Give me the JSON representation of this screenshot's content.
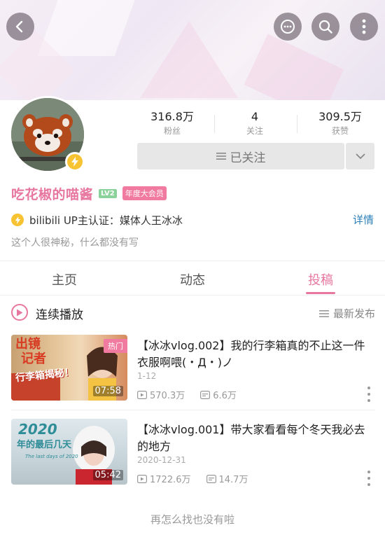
{
  "header": {
    "back_icon": "back-arrow-icon",
    "message_icon": "message-dots-icon",
    "search_icon": "search-icon",
    "more_icon": "more-vertical-icon"
  },
  "profile": {
    "name": "吃花椒的喵酱",
    "level": "LV2",
    "vip_badge": "年度大会员",
    "stats": {
      "fans_value": "316.8万",
      "fans_label": "粉丝",
      "following_value": "4",
      "following_label": "关注",
      "likes_value": "309.5万",
      "likes_label": "获赞"
    },
    "follow_button": "已关注",
    "certification": "bilibili UP主认证：媒体人王冰冰",
    "detail_link": "详情",
    "bio": "这个人很神秘，什么都没有写"
  },
  "tabs": [
    {
      "label": "主页"
    },
    {
      "label": "动态"
    },
    {
      "label": "投稿"
    }
  ],
  "playlist": {
    "play_label": "连续播放",
    "sort_label": "最新发布"
  },
  "videos": [
    {
      "title": "【冰冰vlog.002】我的行李箱真的不止这一件衣服啊喂(・Д・)ノ",
      "date": "1-12",
      "views": "570.3万",
      "danmaku": "6.6万",
      "duration": "07:58",
      "tag": "热门",
      "thumb_text_1": "出镜",
      "thumb_text_2": "记者",
      "thumb_text_3": "行李箱揭秘！"
    },
    {
      "title": "【冰冰vlog.001】带大家看看每个冬天我必去的地方",
      "date": "2020-12-31",
      "views": "1722.6万",
      "danmaku": "14.7万",
      "duration": "05:42",
      "thumb_text_1": "2020",
      "thumb_text_2": "年的最后几天",
      "thumb_text_3": "The last days of 2020"
    }
  ],
  "footer": {
    "end_message": "再怎么找也没有啦"
  },
  "colors": {
    "accent_pink": "#e7779f",
    "link_blue": "#2b7fb8",
    "cert_yellow": "#f8c333"
  }
}
